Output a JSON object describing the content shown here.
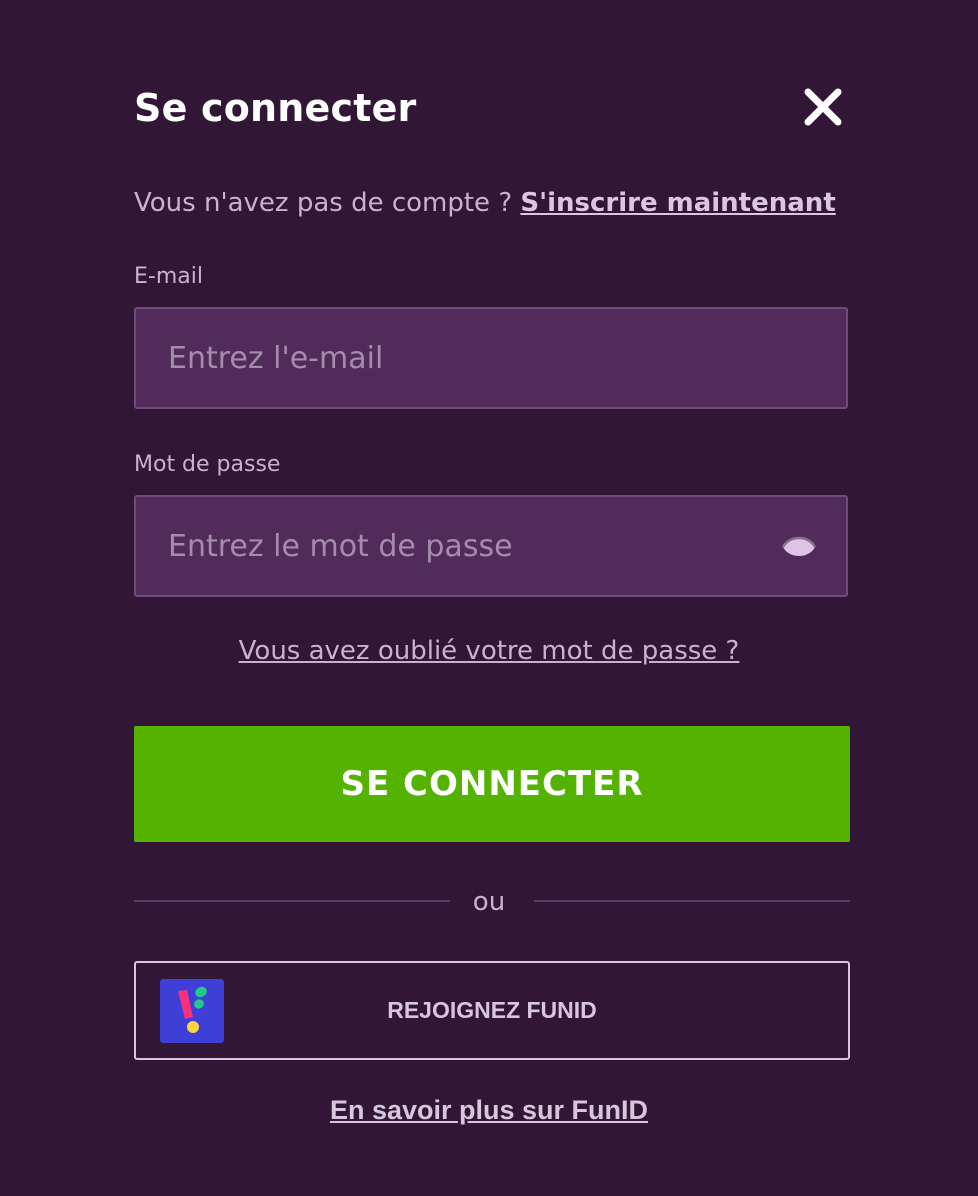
{
  "login": {
    "title": "Se connecter",
    "close_icon": "close-icon",
    "signup_prompt": "Vous n'avez pas de compte ? ",
    "signup_link": "S'inscrire maintenant",
    "email": {
      "label": "E-mail",
      "placeholder": "Entrez l'e-mail",
      "value": ""
    },
    "password": {
      "label": "Mot de passe",
      "placeholder": "Entrez le mot de passe",
      "value": "",
      "toggle_icon": "eye-icon"
    },
    "forgot_link": "Vous avez oublié votre mot de passe ?",
    "submit_label": "SE CONNECTER",
    "divider_text": "ou",
    "funid_button_label": "REJOIGNEZ FUNID",
    "funid_logo_icon": "funid-logo-icon",
    "learn_more_link": "En savoir plus sur FunID"
  },
  "colors": {
    "background": "#311735",
    "input_background": "#512c5a",
    "primary_button": "#53b300",
    "funid_logo_background": "#3d3fd6",
    "muted_text": "#c7b4cc"
  }
}
